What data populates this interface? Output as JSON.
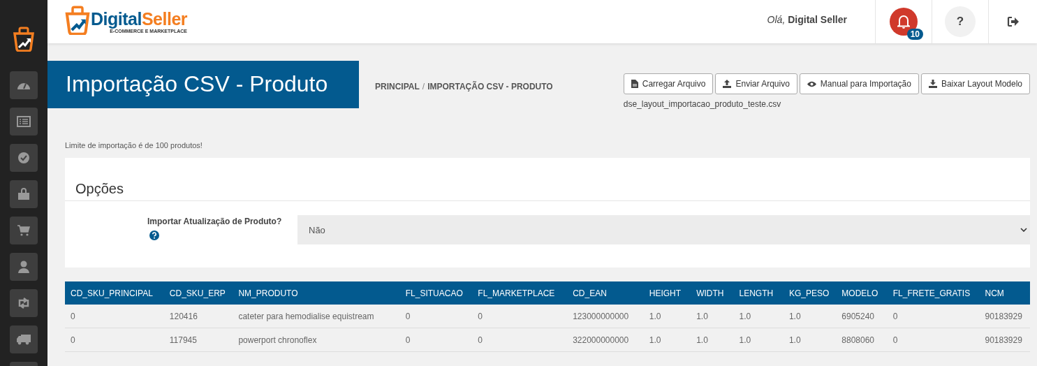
{
  "logo": {
    "name_first": "Digital",
    "name_second": "Seller",
    "tagline": "E-COMMERCE E MARKETPLACE"
  },
  "header": {
    "greeting": "*Olá,* **Digital Seller**",
    "notifications_count": "10",
    "help": "?"
  },
  "page_title": "Importação CSV - Produto",
  "breadcrumb": {
    "items": [
      "PRINCIPAL",
      "IMPORTAÇÃO CSV - PRODUTO"
    ],
    "separator": "/"
  },
  "actions": [
    {
      "kind": "file",
      "label": "Carregar Arquivo"
    },
    {
      "kind": "upload",
      "label": "Enviar Arquivo"
    },
    {
      "kind": "eye",
      "label": "Manual para Importação"
    },
    {
      "kind": "download",
      "label": "Baixar Layout Modelo"
    }
  ],
  "file_name": "dse_layout_importacao_produto_teste.csv",
  "notice": "Limite de importação é de 100 produtos!",
  "options": {
    "title": "Opções",
    "field_label": "Importar Atualização de Produto?",
    "field_value": "Não"
  },
  "table": {
    "columns": [
      "CD_SKU_PRINCIPAL",
      "CD_SKU_ERP",
      "NM_PRODUTO",
      "FL_SITUACAO",
      "FL_MARKETPLACE",
      "CD_EAN",
      "HEIGHT",
      "WIDTH",
      "LENGTH",
      "KG_PESO",
      "MODELO",
      "FL_FRETE_GRATIS",
      "NCM"
    ],
    "rows": [
      [
        "0",
        "120416",
        "cateter para hemodialise equistream",
        "0",
        "0",
        "123000000000",
        "1.0",
        "1.0",
        "1.0",
        "1.0",
        "6905240",
        "0",
        "90183929"
      ],
      [
        "0",
        "117945",
        "powerport chronoflex",
        "0",
        "0",
        "322000000000",
        "1.0",
        "1.0",
        "1.0",
        "1.0",
        "8808060",
        "0",
        "90183929"
      ]
    ]
  }
}
